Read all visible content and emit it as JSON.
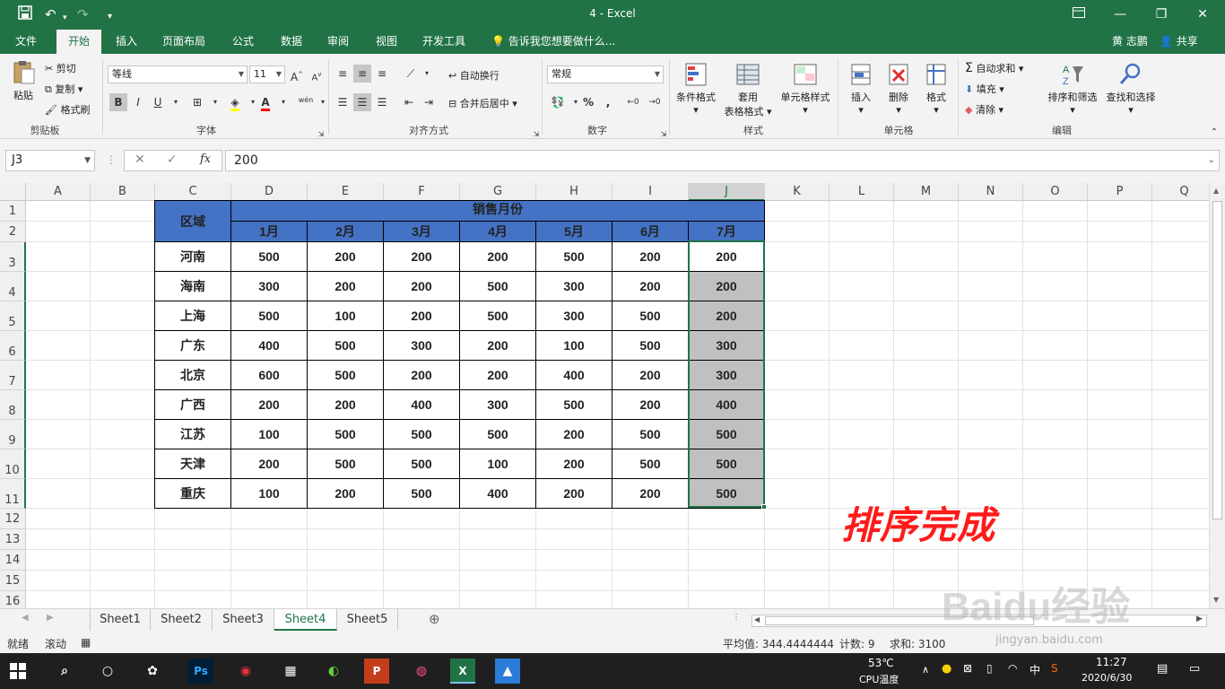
{
  "window": {
    "title": "4 - Excel",
    "quick_access": [
      "save-icon",
      "undo-icon",
      "redo-icon",
      "customize-icon"
    ],
    "controls": [
      "ribbon-display-icon",
      "minimize-icon",
      "restore-icon",
      "close-icon"
    ]
  },
  "tabs": [
    "文件",
    "开始",
    "插入",
    "页面布局",
    "公式",
    "数据",
    "审阅",
    "视图",
    "开发工具"
  ],
  "active_tab": "开始",
  "tell_me": "告诉我您想要做什么...",
  "user": "黄 志鹏",
  "share": "共享",
  "ribbon": {
    "clipboard": {
      "paste": "粘贴",
      "cut": "剪切",
      "copy": "复制",
      "format_painter": "格式刷",
      "label": "剪贴板"
    },
    "font": {
      "name": "等线",
      "size": "11",
      "label": "字体",
      "phonetic": "wén"
    },
    "alignment": {
      "wrap": "自动换行",
      "merge": "合并后居中",
      "label": "对齐方式"
    },
    "number": {
      "format": "常规",
      "label": "数字"
    },
    "styles": {
      "conditional": "条件格式",
      "table_line1": "套用",
      "table_line2": "表格格式",
      "cell_styles": "单元格样式",
      "label": "样式"
    },
    "cells": {
      "insert": "插入",
      "delete": "删除",
      "format": "格式",
      "label": "单元格"
    },
    "editing": {
      "autosum": "自动求和",
      "fill": "填充",
      "clear": "清除",
      "sort": "排序和筛选",
      "find": "查找和选择",
      "label": "编辑"
    }
  },
  "formula_bar": {
    "name_box": "J3",
    "value": "200",
    "fx": "fx"
  },
  "columns": [
    "A",
    "B",
    "C",
    "D",
    "E",
    "F",
    "G",
    "H",
    "I",
    "J",
    "K",
    "L",
    "M",
    "N",
    "O",
    "P",
    "Q"
  ],
  "rows": [
    "1",
    "2",
    "3",
    "4",
    "5",
    "6",
    "7",
    "8",
    "9",
    "10",
    "11",
    "12",
    "13",
    "14",
    "15",
    "16"
  ],
  "table": {
    "region_header": "区域",
    "sales_header": "销售月份",
    "months": [
      "1月",
      "2月",
      "3月",
      "4月",
      "5月",
      "6月",
      "7月"
    ],
    "data": [
      [
        "河南",
        "500",
        "200",
        "200",
        "200",
        "500",
        "200",
        "200"
      ],
      [
        "海南",
        "300",
        "200",
        "200",
        "500",
        "300",
        "200",
        "200"
      ],
      [
        "上海",
        "500",
        "100",
        "200",
        "500",
        "300",
        "500",
        "200"
      ],
      [
        "广东",
        "400",
        "500",
        "300",
        "200",
        "100",
        "500",
        "300"
      ],
      [
        "北京",
        "600",
        "500",
        "200",
        "200",
        "400",
        "200",
        "300"
      ],
      [
        "广西",
        "200",
        "200",
        "400",
        "300",
        "500",
        "200",
        "400"
      ],
      [
        "江苏",
        "100",
        "500",
        "500",
        "500",
        "200",
        "500",
        "500"
      ],
      [
        "天津",
        "200",
        "500",
        "500",
        "100",
        "200",
        "500",
        "500"
      ],
      [
        "重庆",
        "100",
        "200",
        "500",
        "400",
        "200",
        "200",
        "500"
      ]
    ]
  },
  "annotation": "排序完成",
  "watermark": {
    "text": "Baidu经验",
    "url": "jingyan.baidu.com"
  },
  "sheets": [
    "Sheet1",
    "Sheet2",
    "Sheet3",
    "Sheet4",
    "Sheet5"
  ],
  "active_sheet": "Sheet4",
  "status": {
    "ready": "就绪",
    "scroll": "滚动",
    "average": "平均值: 344.4444444",
    "count": "计数: 9",
    "sum": "求和: 3100"
  },
  "taskbar": {
    "temp": "53℃",
    "cpu": "CPU温度",
    "time": "11:27",
    "date": "2020/6/30",
    "ime": "中"
  },
  "colors": {
    "excel_green": "#217346",
    "header_blue": "#4472c4",
    "sorted_gray": "#c0c0c0",
    "annotation_red": "#ff1a1a"
  }
}
